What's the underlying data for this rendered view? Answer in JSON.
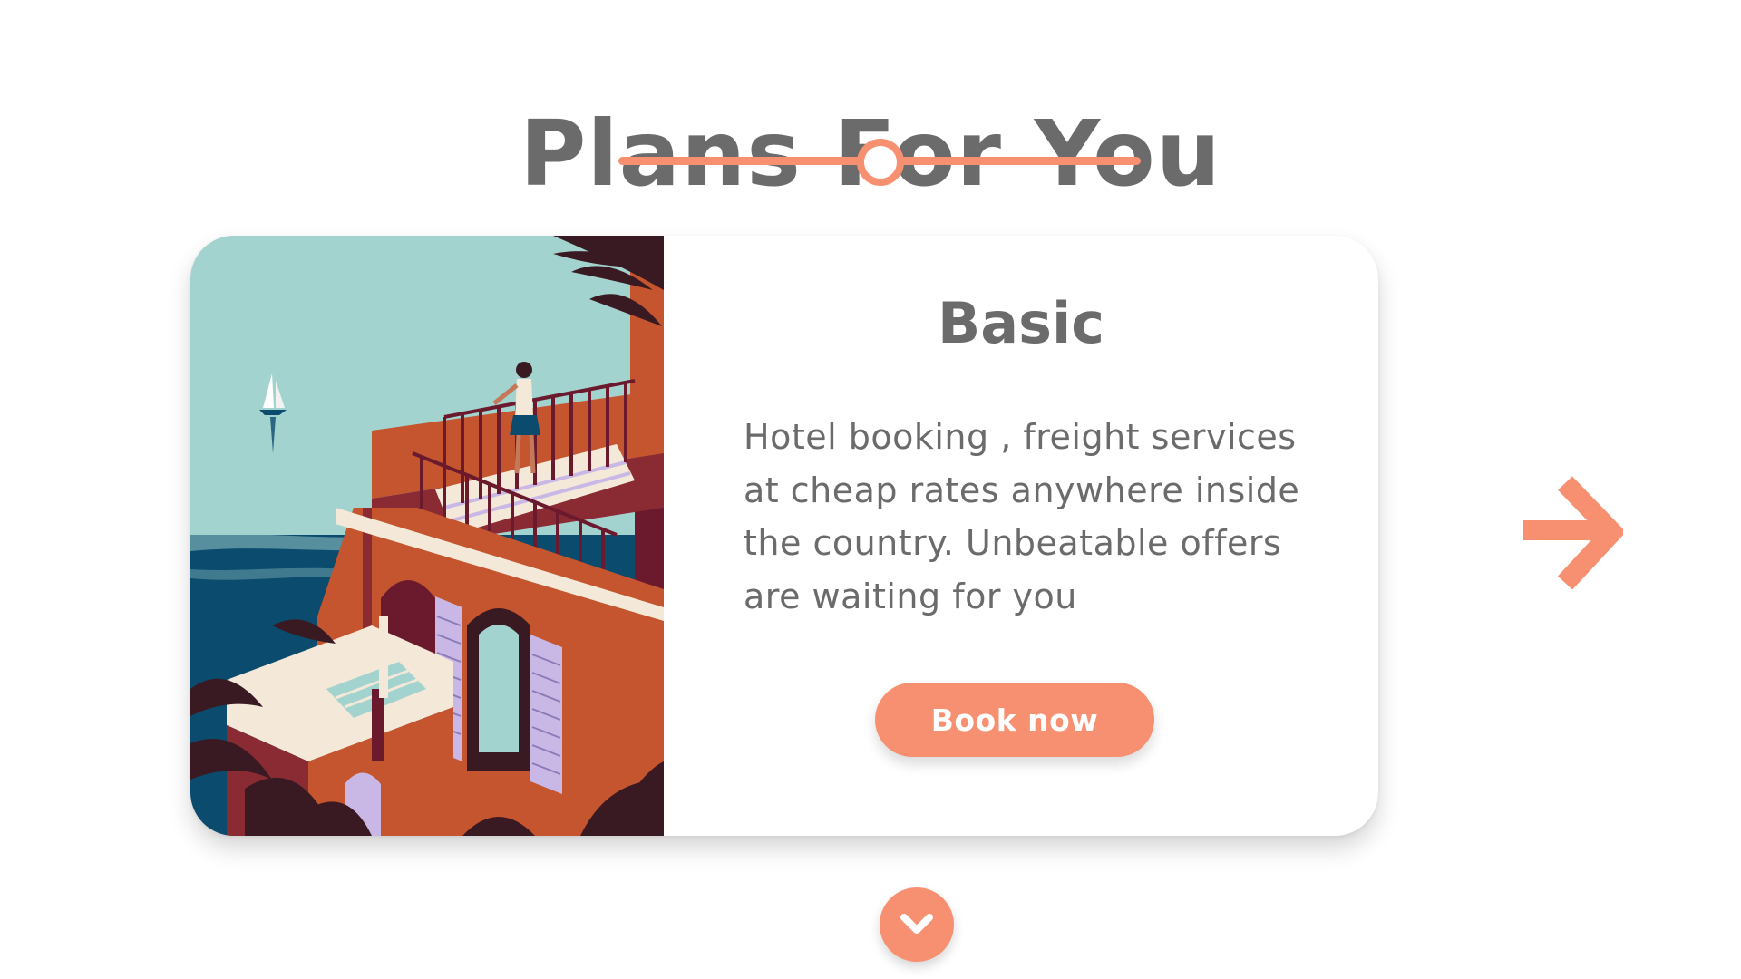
{
  "section": {
    "title": "Plans For You"
  },
  "plan": {
    "title": "Basic",
    "description": "Hotel booking , freight services at cheap rates anywhere inside the country. Unbeatable offers are waiting for you",
    "button_label": "Book now",
    "image_icon": "hotel-balcony-illustration"
  },
  "navigation": {
    "next_icon": "arrow-right-icon",
    "scroll_icon": "chevron-down-icon"
  },
  "colors": {
    "accent": "#f79071",
    "text": "#6b6b6b",
    "background": "#ffffff"
  }
}
